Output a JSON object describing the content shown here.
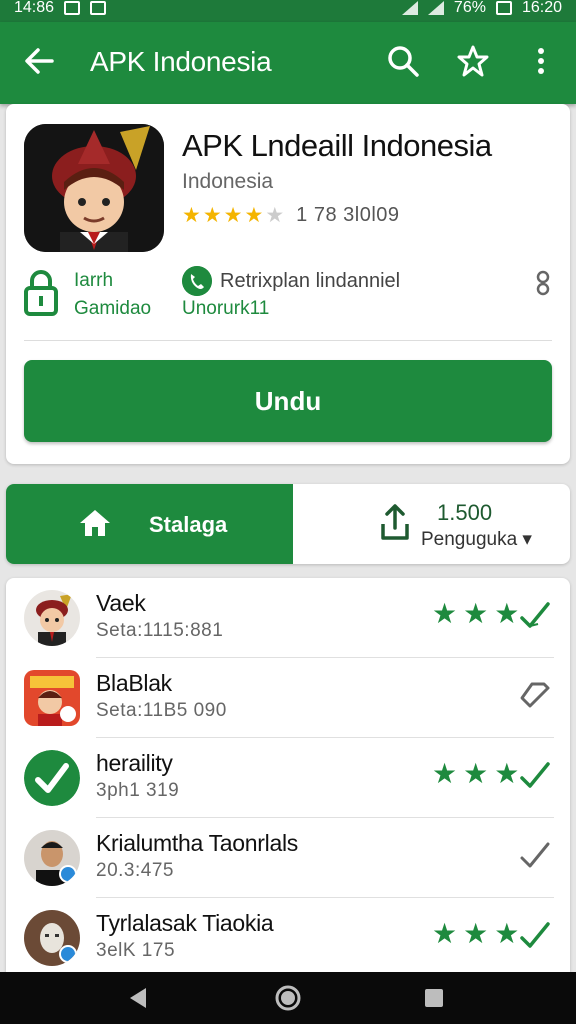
{
  "status_bar": {
    "time_left": "14:86",
    "battery": "76%",
    "time_right": "16:20"
  },
  "app_bar": {
    "title": "APK Indonesia",
    "back_icon": "arrow-left-icon",
    "search_icon": "search-icon",
    "favorite_icon": "star-outline-icon",
    "menu_icon": "more-vert-icon"
  },
  "app": {
    "name": "APK Lndeaill Indonesia",
    "developer": "Indonesia",
    "stars_filled": 4,
    "stars_total": 5,
    "rating_text": "1 78 3l0l09",
    "meta_left": {
      "line1": "Iarrh",
      "line2": "Gamidao"
    },
    "meta_right": {
      "line1": "Retrixplan lindanniel",
      "line2": "Unorurk11"
    },
    "install_label": "Undu"
  },
  "tabs": {
    "home_label": "Stalaga",
    "uploads_count": "1.500",
    "uploads_label": "Penguguka ▾"
  },
  "list": [
    {
      "name": "Vaek",
      "sub": "Seta:1115:881",
      "stars": 3,
      "checked": true
    },
    {
      "name": "BlaBlak",
      "sub": "Seta:11B5 090",
      "stars": 0,
      "checked": false
    },
    {
      "name": "heraility",
      "sub": "3ph1 319",
      "stars": 3,
      "checked": true
    },
    {
      "name": "Krialumtha Taonrlals",
      "sub": "20.3:475",
      "stars": 0,
      "checked": false
    },
    {
      "name": "Tyrlalasak Tiaokia",
      "sub": "3elK 175",
      "stars": 3,
      "checked": true
    }
  ],
  "colors": {
    "primary": "#1e8a3e",
    "star_gold": "#f4b400"
  }
}
